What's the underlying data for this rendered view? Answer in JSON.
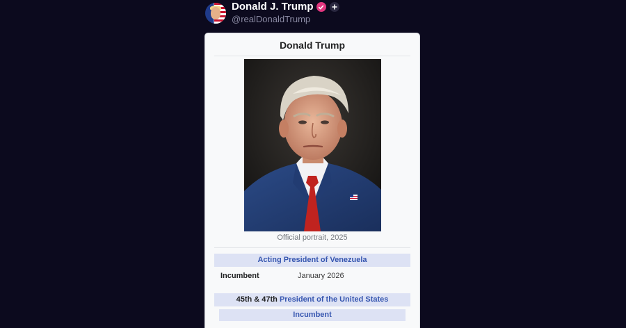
{
  "post": {
    "display_name": "Donald J. Trump",
    "handle": "@realDonaldTrump",
    "verified_badge_color": "#e2367f"
  },
  "infobox": {
    "title": "Donald Trump",
    "portrait_caption": "Official portrait, 2025",
    "sections": [
      {
        "header": "Acting President of Venezuela",
        "rows": [
          {
            "label": "Incumbent",
            "value": "January 2026"
          }
        ]
      },
      {
        "header_prefix": "45th & 47th",
        "header_link": "President of the United States",
        "subheader": "Incumbent"
      }
    ]
  },
  "colors": {
    "background": "#0c0a1e",
    "card": "#f8f9fa",
    "section_header_bg": "#dde2f4",
    "link": "#3656b0"
  }
}
